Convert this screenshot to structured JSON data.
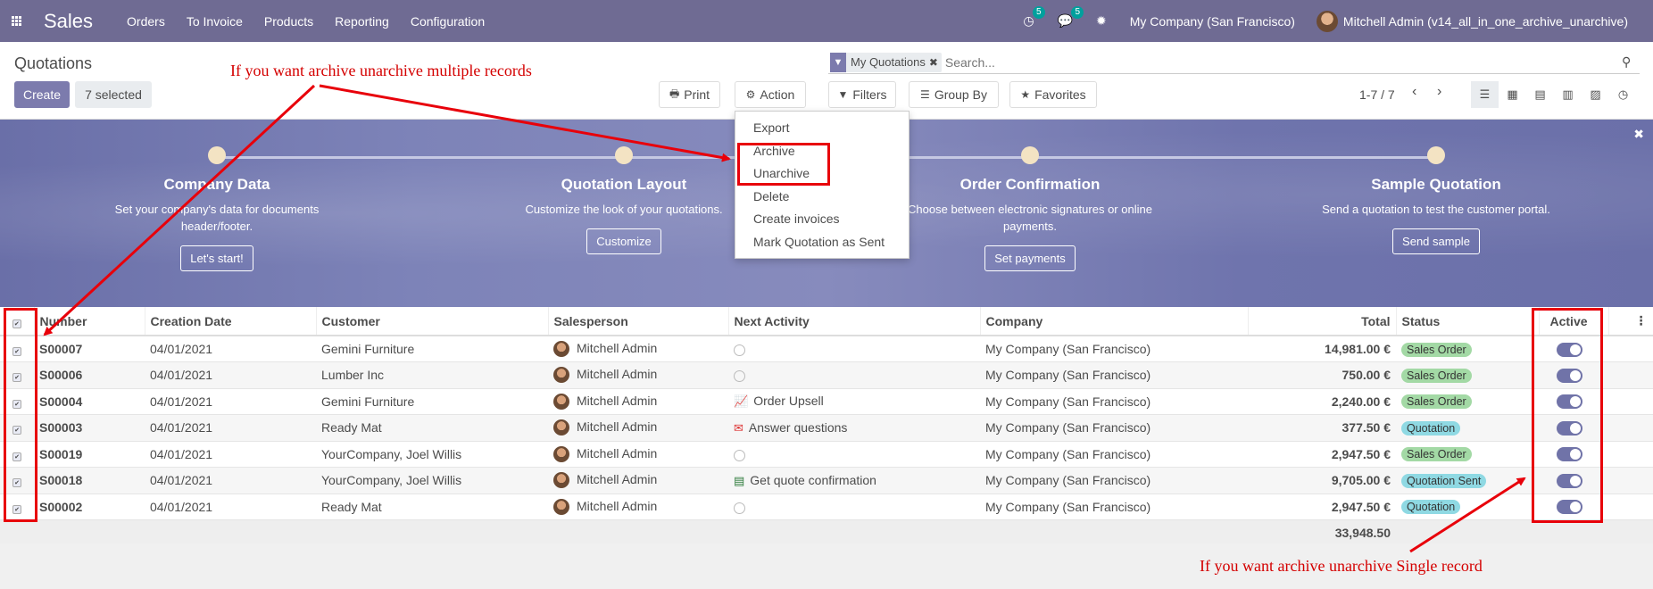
{
  "navbar": {
    "app_title": "Sales",
    "menu": [
      "Orders",
      "To Invoice",
      "Products",
      "Reporting",
      "Configuration"
    ],
    "activity_count": "5",
    "message_count": "5",
    "company": "My Company (San Francisco)",
    "user": "Mitchell Admin (v14_all_in_one_archive_unarchive)"
  },
  "control_panel": {
    "breadcrumb": "Quotations",
    "create_label": "Create",
    "selected_label": "7 selected",
    "print_label": "Print",
    "action_label": "Action",
    "filters_label": "Filters",
    "groupby_label": "Group By",
    "favorites_label": "Favorites",
    "search_facet": "My Quotations",
    "search_placeholder": "Search...",
    "pager": "1-7 / 7"
  },
  "action_menu": [
    "Export",
    "Archive",
    "Unarchive",
    "Delete",
    "Create invoices",
    "Mark Quotation as Sent"
  ],
  "banner": {
    "steps": [
      {
        "title": "Company Data",
        "desc": "Set your company's data for documents header/footer.",
        "button": "Let's start!"
      },
      {
        "title": "Quotation Layout",
        "desc": "Customize the look of your quotations.",
        "button": "Customize"
      },
      {
        "title": "Order Confirmation",
        "desc": "Choose between electronic signatures or online payments.",
        "button": "Set payments"
      },
      {
        "title": "Sample Quotation",
        "desc": "Send a quotation to test the customer portal.",
        "button": "Send sample"
      }
    ]
  },
  "table": {
    "headers": {
      "number": "Number",
      "creation_date": "Creation Date",
      "customer": "Customer",
      "salesperson": "Salesperson",
      "next_activity": "Next Activity",
      "company": "Company",
      "total": "Total",
      "status": "Status",
      "active": "Active"
    },
    "rows": [
      {
        "number": "S00007",
        "date": "04/01/2021",
        "customer": "Gemini Furniture",
        "salesperson": "Mitchell Admin",
        "activity": "",
        "activity_icon": "clock-icon",
        "company": "My Company (San Francisco)",
        "total": "14,981.00 €",
        "status": "Sales Order",
        "status_color": "#a3d9a5"
      },
      {
        "number": "S00006",
        "date": "04/01/2021",
        "customer": "Lumber Inc",
        "salesperson": "Mitchell Admin",
        "activity": "",
        "activity_icon": "clock-icon",
        "company": "My Company (San Francisco)",
        "total": "750.00 €",
        "status": "Sales Order",
        "status_color": "#a3d9a5"
      },
      {
        "number": "S00004",
        "date": "04/01/2021",
        "customer": "Gemini Furniture",
        "salesperson": "Mitchell Admin",
        "activity": "Order Upsell",
        "activity_icon": "line-chart-icon",
        "company": "My Company (San Francisco)",
        "total": "2,240.00 €",
        "status": "Sales Order",
        "status_color": "#a3d9a5"
      },
      {
        "number": "S00003",
        "date": "04/01/2021",
        "customer": "Ready Mat",
        "salesperson": "Mitchell Admin",
        "activity": "Answer questions",
        "activity_icon": "envelope-icon",
        "company": "My Company (San Francisco)",
        "total": "377.50 €",
        "status": "Quotation",
        "status_color": "#8fd9e3"
      },
      {
        "number": "S00019",
        "date": "04/01/2021",
        "customer": "YourCompany, Joel Willis",
        "salesperson": "Mitchell Admin",
        "activity": "",
        "activity_icon": "clock-icon",
        "company": "My Company (San Francisco)",
        "total": "2,947.50 €",
        "status": "Sales Order",
        "status_color": "#a3d9a5"
      },
      {
        "number": "S00018",
        "date": "04/01/2021",
        "customer": "YourCompany, Joel Willis",
        "salesperson": "Mitchell Admin",
        "activity": "Get quote confirmation",
        "activity_icon": "list-icon",
        "company": "My Company (San Francisco)",
        "total": "9,705.00 €",
        "status": "Quotation Sent",
        "status_color": "#8fd9e3"
      },
      {
        "number": "S00002",
        "date": "04/01/2021",
        "customer": "Ready Mat",
        "salesperson": "Mitchell Admin",
        "activity": "",
        "activity_icon": "clock-icon",
        "company": "My Company (San Francisco)",
        "total": "2,947.50 €",
        "status": "Quotation",
        "status_color": "#8fd9e3"
      }
    ],
    "grand_total": "33,948.50"
  },
  "annotations": {
    "multiple": "If you want archive unarchive multiple records",
    "single": "If you want archive unarchive Single record"
  },
  "colors": {
    "navbar": "#6f6b93",
    "primary": "#7c7bad",
    "annotation": "#d40000"
  }
}
